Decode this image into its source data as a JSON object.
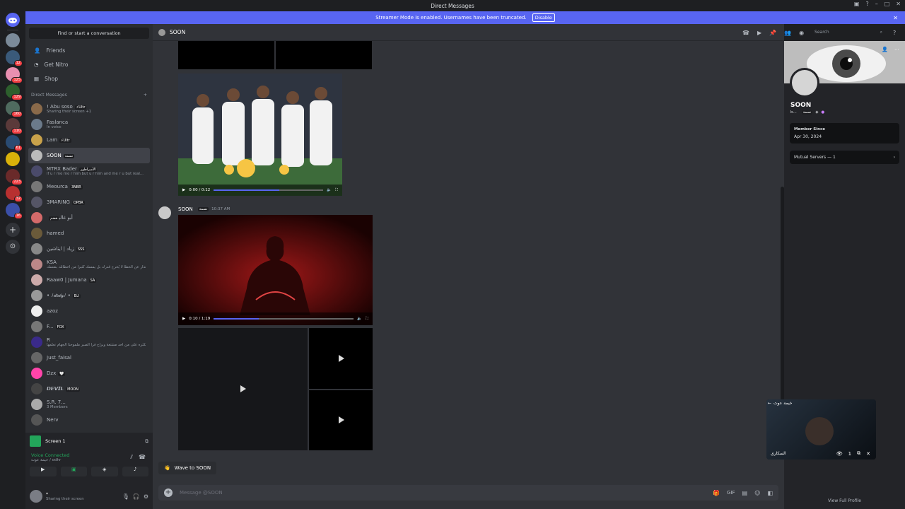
{
  "window": {
    "title": "Direct Messages"
  },
  "banner": {
    "text": "Streamer Mode is enabled. Usernames have been truncated.",
    "button": "Disable"
  },
  "servers": {
    "badges": [
      "12",
      "125",
      "129",
      "160",
      "110",
      "61",
      "223",
      "32",
      "16"
    ]
  },
  "sidebar": {
    "search_placeholder": "Find or start a conversation",
    "nav": [
      {
        "label": "Friends"
      },
      {
        "label": "Get Nitro"
      },
      {
        "label": "Shop"
      }
    ],
    "dm_header": "Direct Messages",
    "dms": [
      {
        "name": "! Abu soso",
        "tag": "⚡Ultr",
        "sub": "Sharing their screen +1"
      },
      {
        "name": "Faslanca",
        "tag": "",
        "sub": "In voice"
      },
      {
        "name": "Lam",
        "tag": "⚡Ultr",
        "sub": ""
      },
      {
        "name": "SOON",
        "tag": "نسمة",
        "sub": ""
      },
      {
        "name": "MTRX Bader",
        "tag": "الأمبراطور",
        "sub": "if u r me me r him but u r him and me r u but real..."
      },
      {
        "name": "Meourca",
        "tag": "3NBR",
        "sub": ""
      },
      {
        "name": "3MARING",
        "tag": "OPBR",
        "sub": ""
      },
      {
        "name": "أبو غالب",
        "tag": "غضم",
        "sub": ""
      },
      {
        "name": "hamed",
        "tag": "",
        "sub": ""
      },
      {
        "name": "زياد | ايتاشين",
        "tag": "SSS",
        "sub": ""
      },
      {
        "name": "KSA",
        "tag": "",
        "sub": "الاعتذار عن الخطأ لا يُخرج قدرك بل يمسك كثيراً من اخطائك بنفسك"
      },
      {
        "name": "Raaw0 | Jumana",
        "tag": "SA",
        "sub": ""
      },
      {
        "name": "• ﾉ𝒹𝑜𝒹𝓎ﾉ •",
        "tag": "ᗷᒍ",
        "sub": ""
      },
      {
        "name": "azoz",
        "tag": "",
        "sub": ""
      },
      {
        "name": "F...",
        "tag": "FOX",
        "sub": ""
      },
      {
        "name": "R",
        "tag": "",
        "sub": "يكتره على من أحد مشتعة ويراح فرا الصبر ملموحتا الجهام نعلمها"
      },
      {
        "name": "Just_faisal",
        "tag": "",
        "sub": ""
      },
      {
        "name": "Dzx",
        "tag": "🤍",
        "sub": ""
      },
      {
        "name": "𝘿𝙀𝙑𝙄𝙇",
        "tag": "MOON",
        "sub": ""
      },
      {
        "name": "S.R. 7...",
        "tag": "",
        "sub": "3 Members"
      },
      {
        "name": "Nerv",
        "tag": "",
        "sub": ""
      }
    ]
  },
  "panel": {
    "screen_label": "Screen 1",
    "voice_status": "Voice Connected",
    "voice_channel": "خيمة عوث / odhr",
    "user_status": "Sharing their screen"
  },
  "chat": {
    "header_name": "SOON",
    "search_placeholder": "Search",
    "video1_time": "0:00 / 0:12",
    "video1_progress": 0.6,
    "message_author": "SOON",
    "message_author_tag": "نسمة",
    "message_time": "10:37 AM",
    "video2_time": "0:10 / 1:19",
    "video2_progress": 0.32,
    "wave_label": "Wave to SOON",
    "composer_placeholder": "Message @SOON"
  },
  "profile": {
    "name": "SOON",
    "sub": "b...",
    "tag": "نسمة",
    "member_since_label": "Member Since",
    "member_since": "Apr 30, 2024",
    "mutual_servers": "Mutual Servers — 1",
    "view_full": "View Full Profile"
  },
  "pip": {
    "title": "خيمة عوث",
    "user": "السكاري",
    "viewers": "1"
  }
}
